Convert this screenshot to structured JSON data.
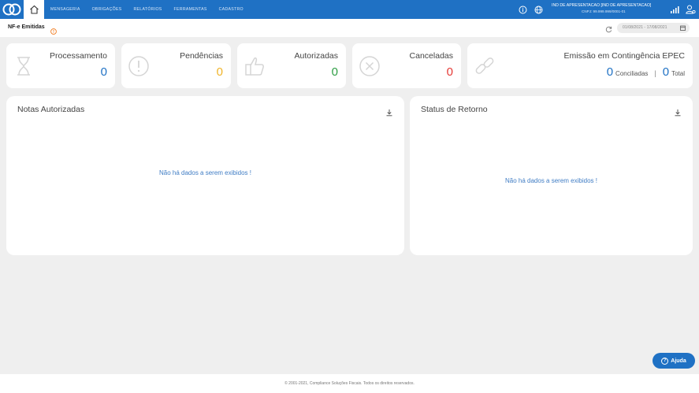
{
  "topbar": {
    "nav": [
      "MENSAGERIA",
      "OBRIGAÇÕES",
      "RELATÓRIOS",
      "FERRAMENTAS",
      "CADASTRO"
    ],
    "company_name": "IND DE APRESENTACAO [IND DE APRESENTACAO]",
    "company_cnpj": "CNPJ: 99.999.999/0001-01"
  },
  "subheader": {
    "title": "NF-e Emitidas",
    "date_range": "01/08/2021 - 17/08/2021"
  },
  "cards": {
    "processamento": {
      "label": "Processamento",
      "value": "0",
      "color": "#1f71c4"
    },
    "pendencias": {
      "label": "Pendências",
      "value": "0",
      "color": "#f0b429"
    },
    "autorizadas": {
      "label": "Autorizadas",
      "value": "0",
      "color": "#2e9e44"
    },
    "canceladas": {
      "label": "Canceladas",
      "value": "0",
      "color": "#e53935"
    },
    "epec": {
      "label": "Emissão em Contingência EPEC",
      "conciliadas_value": "0",
      "conciliadas_label": "Conciliadas",
      "separator": "|",
      "total_value": "0",
      "total_label": "Total"
    }
  },
  "panels": {
    "notas": {
      "title": "Notas Autorizadas",
      "empty": "Não há dados a serem exibidos !"
    },
    "status": {
      "title": "Status de Retorno",
      "empty": "Não há dados a serem exibidos !"
    }
  },
  "help": {
    "label": "Ajuda"
  },
  "footer": {
    "text": "© 2001-2021, Compliance Soluções Fiscais. Todos os direitos reservados."
  },
  "icons": {
    "logo": "logo-icon",
    "home": "home-icon",
    "info": "info-icon",
    "globe": "globe-icon",
    "signal": "signal-icon",
    "user": "user-settings-icon",
    "refresh": "refresh-icon",
    "calendar": "calendar-icon",
    "download": "download-icon"
  }
}
